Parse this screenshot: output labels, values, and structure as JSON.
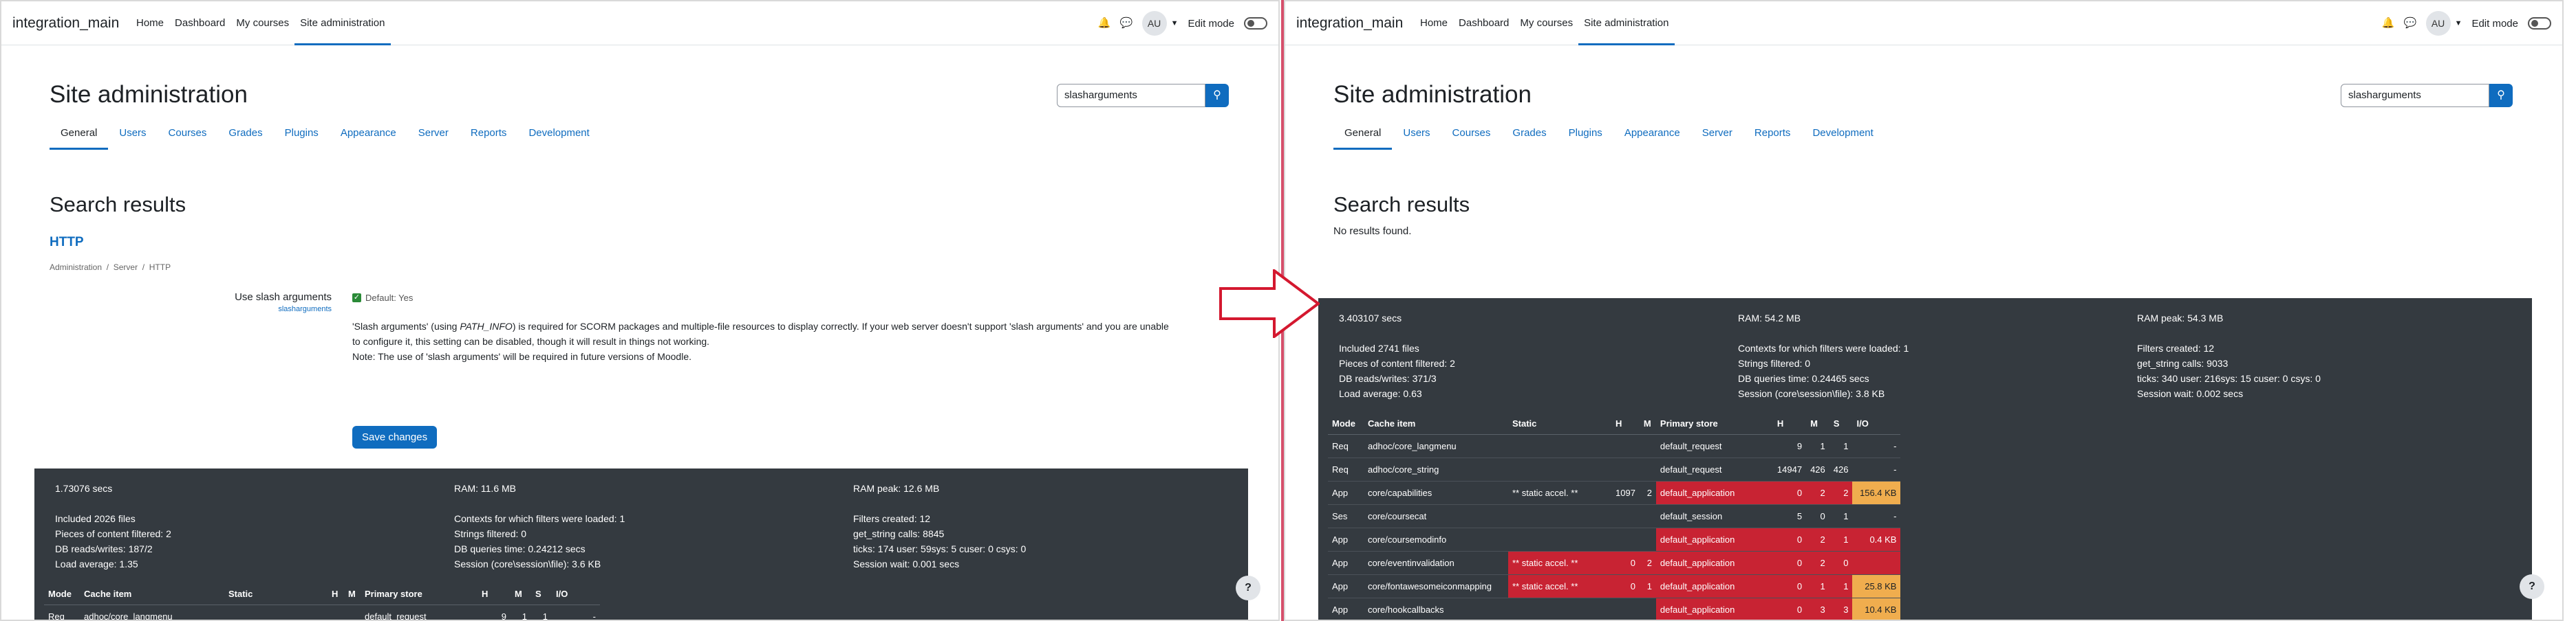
{
  "app": {
    "title": "integration_main"
  },
  "nav": {
    "items": [
      "Home",
      "Dashboard",
      "My courses",
      "Site administration"
    ],
    "active": "Site administration"
  },
  "user": {
    "initials": "AU",
    "edit_mode": "Edit mode"
  },
  "icons": {
    "notifications": "bell-icon",
    "messages": "chat-icon",
    "search": "search-icon",
    "help": "help-icon"
  },
  "colors": {
    "primary": "#0f6cbf",
    "footer": "#343a40",
    "danger": "#c82333",
    "warning": "#f0ad4e",
    "divider": "#d64f6b"
  },
  "page": {
    "title": "Site administration",
    "search_value": "slasharguments"
  },
  "tabs": [
    "General",
    "Users",
    "Courses",
    "Grades",
    "Plugins",
    "Appearance",
    "Server",
    "Reports",
    "Development"
  ],
  "left": {
    "results_title": "Search results",
    "section": "HTTP",
    "breadcrumb": [
      "Administration",
      "Server",
      "HTTP"
    ],
    "setting": {
      "label": "Use slash arguments",
      "name": "slasharguments",
      "default": "Default: Yes",
      "desc1_a": "'Slash arguments' (using ",
      "desc1_em": "PATH_INFO",
      "desc1_b": ") is required for SCORM packages and multiple-file resources to display correctly. If your web server doesn't support 'slash arguments' and you are unable",
      "desc2": "to configure it, this setting can be disabled, though it will result in things not working.",
      "desc3": "Note: The use of 'slash arguments' will be required in future versions of Moodle.",
      "save": "Save changes"
    },
    "perf": {
      "col1": [
        "1.73076 secs",
        "",
        "Included 2026 files",
        "Pieces of content filtered: 2",
        "DB reads/writes: 187/2",
        "Load average: 1.35"
      ],
      "col2": [
        "RAM: 11.6 MB",
        "",
        "Contexts for which filters were loaded: 1",
        "Strings filtered: 0",
        "DB queries time: 0.24212 secs",
        "Session (core\\session\\file): 3.6 KB"
      ],
      "col3": [
        "RAM peak: 12.6 MB",
        "",
        "Filters created: 12",
        "get_string calls: 8845",
        "ticks: 174 user: 59sys: 5 cuser: 0 csys: 0",
        "Session wait: 0.001 secs"
      ]
    },
    "cache_rows": [
      {
        "mode": "Req",
        "item": "adhoc/core_langmenu",
        "static": "",
        "h1": "",
        "m1": "",
        "store": "default_request",
        "h": "9",
        "m": "1",
        "s": "1",
        "io": "-"
      }
    ]
  },
  "right": {
    "results_title": "Search results",
    "no_results": "No results found.",
    "perf": {
      "col1": [
        "3.403107 secs",
        "",
        "Included 2741 files",
        "Pieces of content filtered: 2",
        "DB reads/writes: 371/3",
        "Load average: 0.63"
      ],
      "col2": [
        "RAM: 54.2 MB",
        "",
        "Contexts for which filters were loaded: 1",
        "Strings filtered: 0",
        "DB queries time: 0.24465 secs",
        "Session (core\\session\\file): 3.8 KB"
      ],
      "col3": [
        "RAM peak: 54.3 MB",
        "",
        "Filters created: 12",
        "get_string calls: 9033",
        "ticks: 340 user: 216sys: 15 cuser: 0 csys: 0",
        "Session wait: 0.002 secs"
      ]
    },
    "cache_rows": [
      {
        "mode": "Req",
        "item": "adhoc/core_langmenu",
        "static": "",
        "h1": "",
        "m1": "",
        "store": "default_request",
        "h": "9",
        "m": "1",
        "s": "1",
        "io": "-"
      },
      {
        "mode": "Req",
        "item": "adhoc/core_string",
        "static": "",
        "h1": "",
        "m1": "",
        "store": "default_request",
        "h": "14947",
        "m": "426",
        "s": "426",
        "io": "-"
      },
      {
        "mode": "App",
        "item": "core/capabilities",
        "static": "** static accel. **",
        "h1": "1097",
        "m1": "2",
        "store": "default_application",
        "h": "0",
        "m": "2",
        "s": "2",
        "io": "156.4 KB",
        "hl_store": true,
        "hl_io": true
      },
      {
        "mode": "Ses",
        "item": "core/coursecat",
        "static": "",
        "h1": "",
        "m1": "",
        "store": "default_session",
        "h": "5",
        "m": "0",
        "s": "1",
        "io": "-"
      },
      {
        "mode": "App",
        "item": "core/coursemodinfo",
        "static": "",
        "h1": "",
        "m1": "",
        "store": "default_application",
        "h": "0",
        "m": "2",
        "s": "1",
        "io": "0.4 KB",
        "hl_store": true,
        "hl_io_red": true
      },
      {
        "mode": "App",
        "item": "core/eventinvalidation",
        "static": "** static accel. **",
        "h1": "0",
        "m1": "2",
        "store": "default_application",
        "h": "0",
        "m": "2",
        "s": "0",
        "io": "",
        "hl_static": true,
        "hl_store": true,
        "hl_io_red": true
      },
      {
        "mode": "App",
        "item": "core/fontawesomeiconmapping",
        "static": "** static accel. **",
        "h1": "0",
        "m1": "1",
        "store": "default_application",
        "h": "0",
        "m": "1",
        "s": "1",
        "io": "25.8 KB",
        "hl_static": true,
        "hl_store": true,
        "hl_io": true
      },
      {
        "mode": "App",
        "item": "core/hookcallbacks",
        "static": "",
        "h1": "",
        "m1": "",
        "store": "default_application",
        "h": "0",
        "m": "3",
        "s": "3",
        "io": "10.4 KB",
        "hl_store": true,
        "hl_io": true
      }
    ]
  },
  "table_headers": {
    "mode": "Mode",
    "item": "Cache item",
    "static": "Static",
    "h1": "H",
    "m1": "M",
    "store": "Primary store",
    "h": "H",
    "m": "M",
    "s": "S",
    "io": "I/O"
  },
  "help": "?"
}
